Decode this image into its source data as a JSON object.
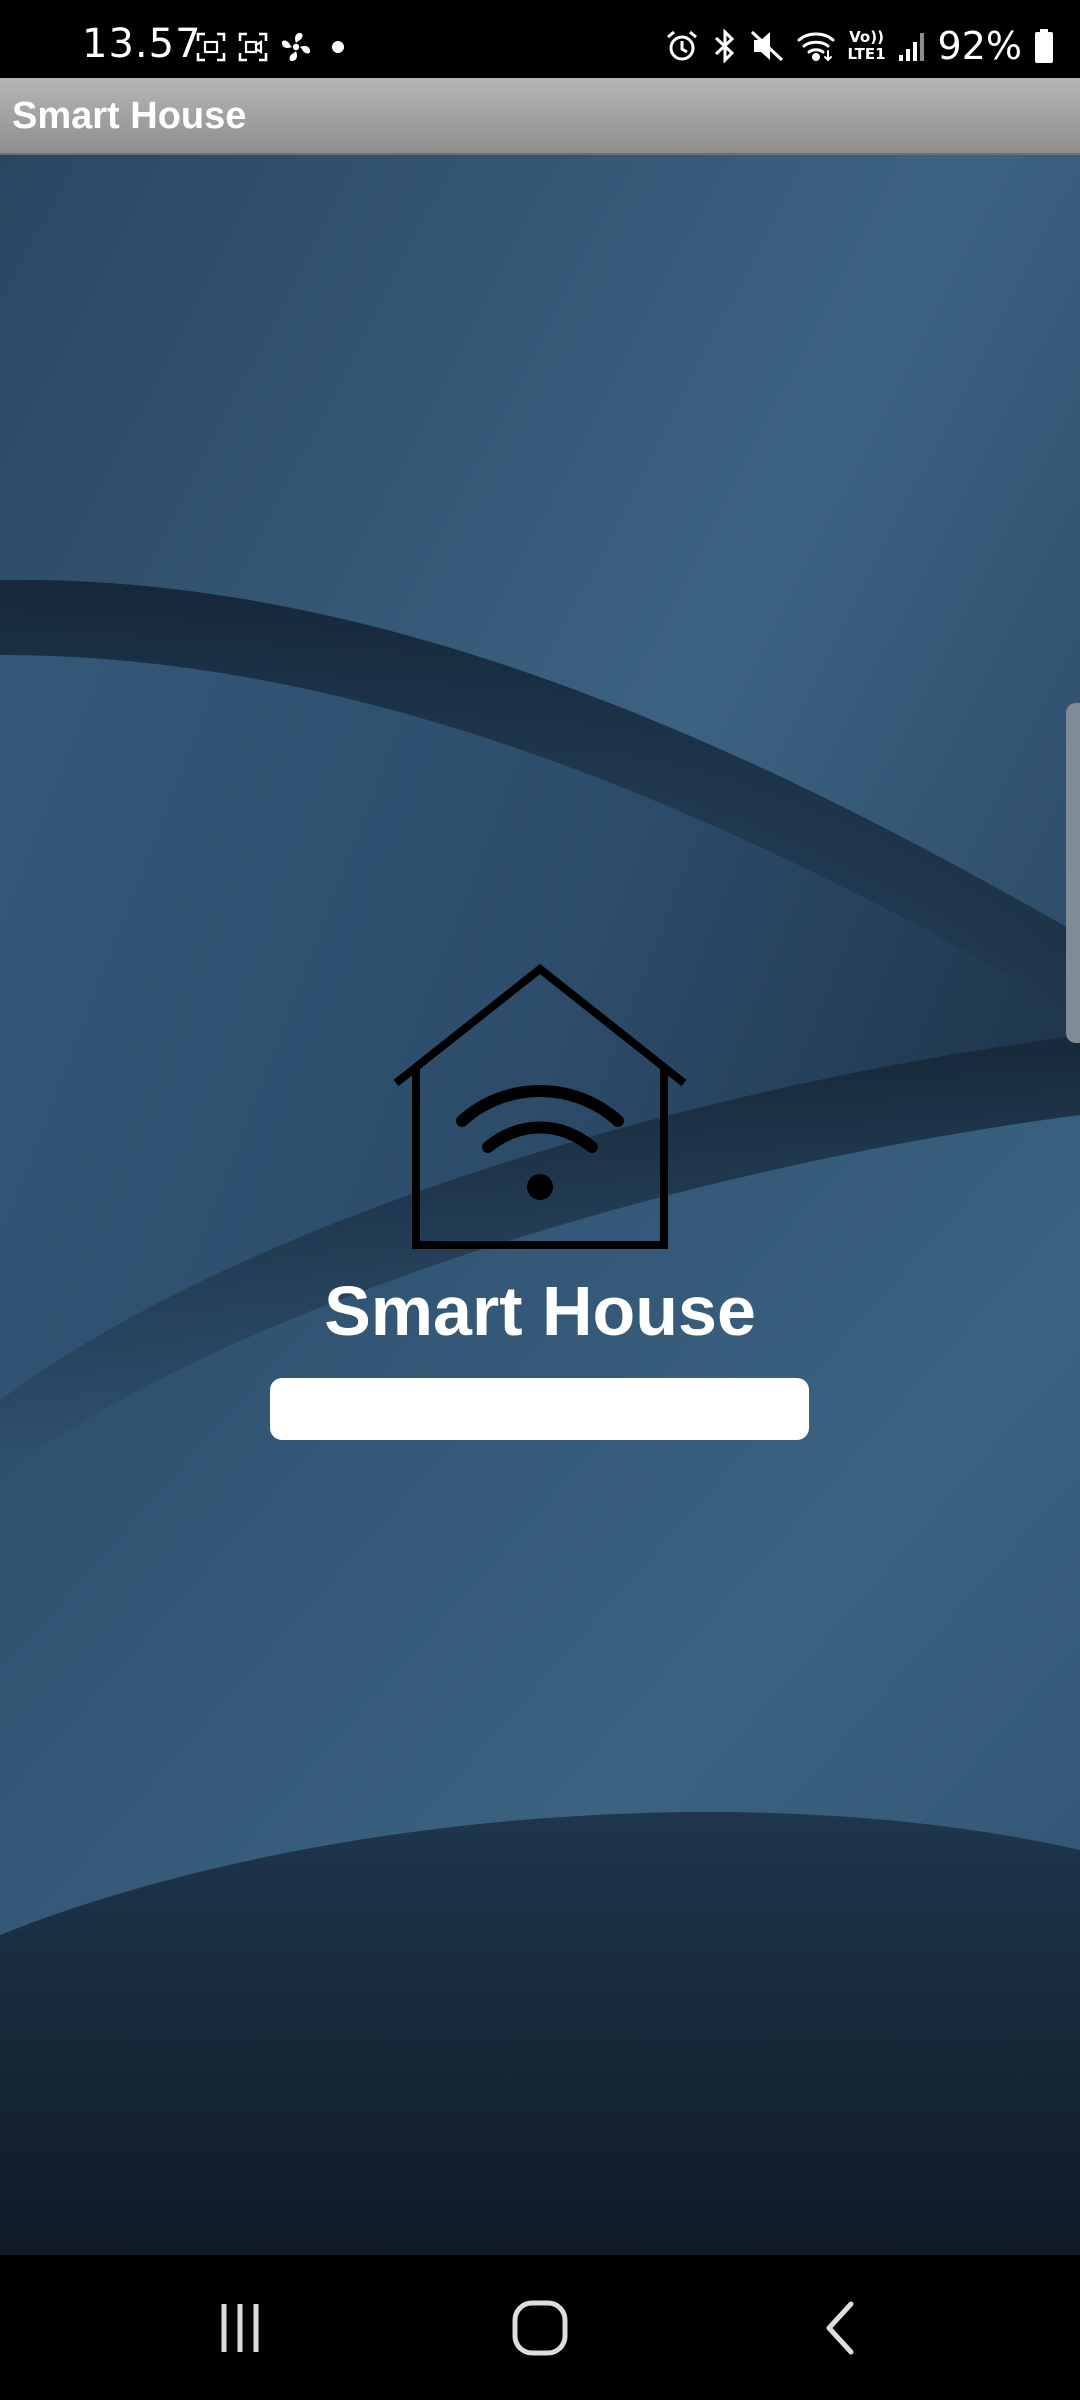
{
  "status_bar": {
    "time": "13.57",
    "battery_percent": "92%",
    "left_icons": [
      "screenshot-icon",
      "screen-record-icon",
      "fan-icon",
      "notification-dot-icon"
    ],
    "right_icons": [
      "alarm-icon",
      "bluetooth-icon",
      "mute-icon",
      "wifi-icon",
      "volte-lte-icon",
      "signal-icon",
      "battery-icon"
    ],
    "network_label_top": "Vo))",
    "network_label_bottom": "LTE1"
  },
  "app_bar": {
    "title": "Smart House"
  },
  "splash": {
    "logo_icon": "smart-home-wifi-icon",
    "title": "Smart House",
    "progress": 1.0
  },
  "nav_bar": {
    "buttons": [
      "recent-apps-icon",
      "home-icon",
      "back-icon"
    ]
  },
  "colors": {
    "background": "#2b4a66",
    "background_dark": "#17283a",
    "app_bar": "#a0a0a0",
    "text": "#ffffff",
    "progress": "#ffffff"
  }
}
